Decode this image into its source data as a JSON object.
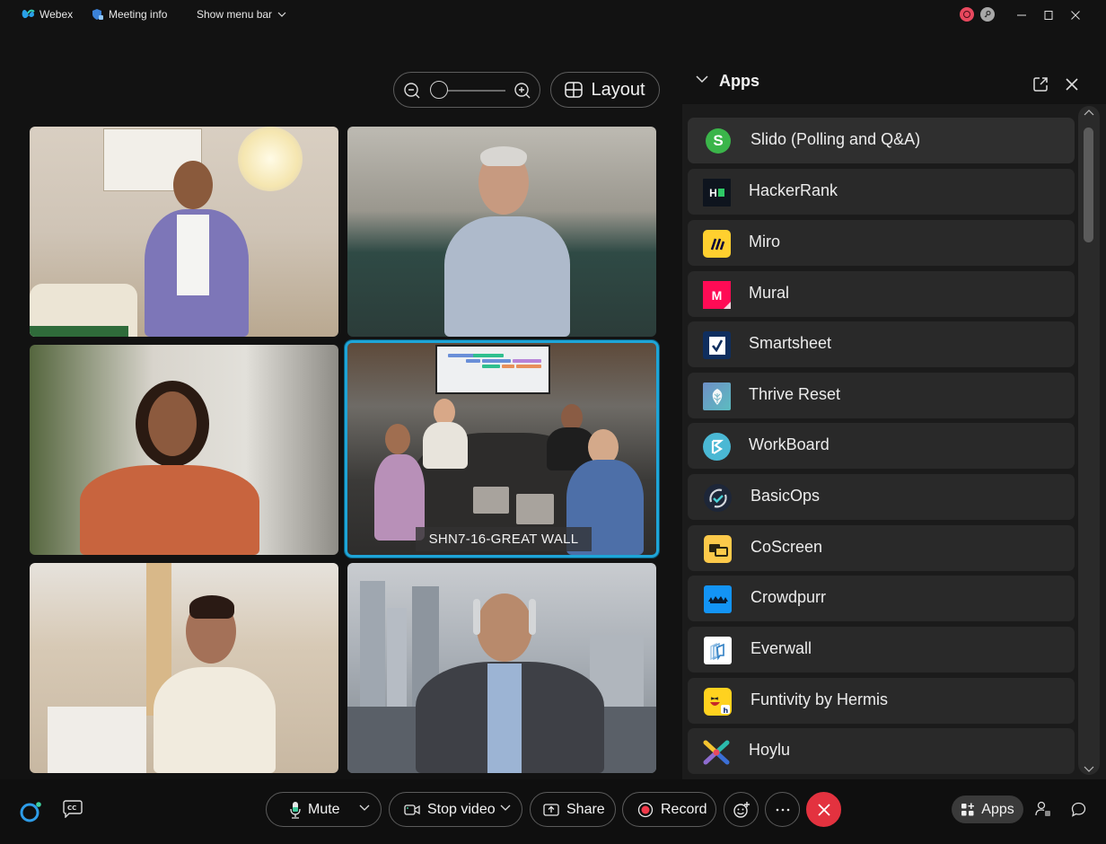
{
  "titlebar": {
    "app_name": "Webex",
    "meeting_info": "Meeting info",
    "show_menu_bar": "Show menu bar",
    "status_icons": [
      "recording-indicator-icon",
      "key-icon"
    ],
    "window_controls": [
      "minimize",
      "maximize",
      "close"
    ]
  },
  "stage": {
    "zoom_control": {
      "zoom_out_icon": "zoom-out-icon",
      "zoom_in_icon": "zoom-in-icon",
      "level_fraction": 0.0
    },
    "layout_label": "Layout",
    "active_speaker_color": "#1ea5d8",
    "tiles": [
      {
        "id": 1,
        "label": ""
      },
      {
        "id": 2,
        "label": ""
      },
      {
        "id": 3,
        "label": ""
      },
      {
        "id": 4,
        "label": "SHN7-16-GREAT WALL",
        "active": true
      },
      {
        "id": 5,
        "label": ""
      },
      {
        "id": 6,
        "label": ""
      }
    ]
  },
  "apps_panel": {
    "title": "Apps",
    "items": [
      {
        "name": "Slido (Polling and Q&A)",
        "icon": "slido-icon",
        "color": "#3bb54a"
      },
      {
        "name": "HackerRank",
        "icon": "hackerrank-icon",
        "color": "#0e141e"
      },
      {
        "name": "Miro",
        "icon": "miro-icon",
        "color": "#ffd02f"
      },
      {
        "name": "Mural",
        "icon": "mural-icon",
        "color": "#ff0b55"
      },
      {
        "name": "Smartsheet",
        "icon": "smartsheet-icon",
        "color": "#0f2e5e"
      },
      {
        "name": "Thrive Reset",
        "icon": "thrive-reset-icon",
        "color": "#4ea5b5"
      },
      {
        "name": "WorkBoard",
        "icon": "workboard-icon",
        "color": "#4ab8d4"
      },
      {
        "name": "BasicOps",
        "icon": "basicops-icon",
        "color": "#1d2638"
      },
      {
        "name": "CoScreen",
        "icon": "coscreen-icon",
        "color": "#fcc94a"
      },
      {
        "name": "Crowdpurr",
        "icon": "crowdpurr-icon",
        "color": "#1394f5"
      },
      {
        "name": "Everwall",
        "icon": "everwall-icon",
        "color": "#ffffff"
      },
      {
        "name": "Funtivity by Hermis",
        "icon": "funtivity-icon",
        "color": "#ffd21f"
      },
      {
        "name": "Hoylu",
        "icon": "hoylu-icon",
        "color": "#e84a5f"
      }
    ]
  },
  "controls": {
    "mute_label": "Mute",
    "stop_video_label": "Stop video",
    "share_label": "Share",
    "record_label": "Record",
    "apps_label": "Apps",
    "end_color": "#e3323f"
  }
}
